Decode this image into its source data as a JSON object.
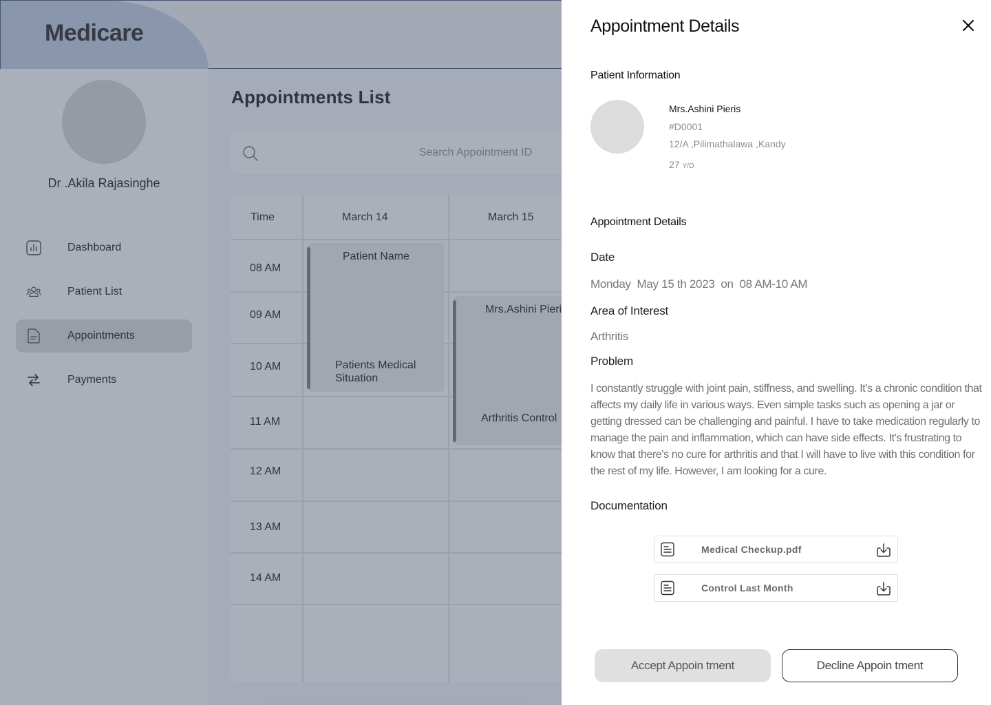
{
  "app": {
    "title": "Medicare"
  },
  "sidebar": {
    "doctor_name": "Dr .Akila Rajasinghe",
    "items": [
      {
        "label": "Dashboard",
        "icon": "chart-icon",
        "active": false
      },
      {
        "label": "Patient List",
        "icon": "users-icon",
        "active": false
      },
      {
        "label": "Appointments",
        "icon": "document-icon",
        "active": true
      },
      {
        "label": "Payments",
        "icon": "arrows-swap-icon",
        "active": false
      }
    ]
  },
  "main": {
    "title": "Appointments List",
    "search": {
      "placeholder": "Search Appointment ID",
      "value": ""
    },
    "calendar": {
      "headers": [
        "Time",
        "March 14",
        "March 15"
      ],
      "times": [
        "08 AM",
        "09 AM",
        "10 AM",
        "11 AM",
        "12 AM",
        "13 AM",
        "14 AM"
      ],
      "appointments": [
        {
          "title": "Patient Name",
          "detail": "Patients Medical Situation"
        },
        {
          "title": "Mrs.Ashini Pieris",
          "detail": "Arthritis Control"
        }
      ]
    }
  },
  "panel": {
    "title": "Appointment Details",
    "patient_section_title": "Patient Information",
    "patient": {
      "name": "Mrs.Ashini Pieris",
      "id": "#D0001",
      "address": "12/A ,Pilimathalawa ,Kandy",
      "age": "27",
      "age_unit": "Y/O"
    },
    "details_section_title": "Appointment Details",
    "date_label": "Date",
    "date_value": "Monday  May 15 th 2023  on  08 AM-10 AM",
    "area_label": "Area of Interest",
    "area_value": "Arthritis",
    "problem_label": "Problem",
    "problem_text": "I constantly struggle with joint pain, stiffness, and swelling. It's a chronic condition that affects my daily life in various ways. Even simple tasks such as opening a jar or getting dressed can be challenging and painful. I have to take medication regularly to manage the pain and inflammation, which can have side effects. It's frustrating to know that there's no cure for arthritis and that I will have to live with this condition for the rest of my life. However, I am looking for a cure.",
    "documentation_label": "Documentation",
    "documents": [
      {
        "name": "Medical Checkup.pdf"
      },
      {
        "name": "Control Last Month"
      }
    ],
    "accept_label": "Accept Appoin tment",
    "decline_label": "Decline Appoin tment"
  }
}
